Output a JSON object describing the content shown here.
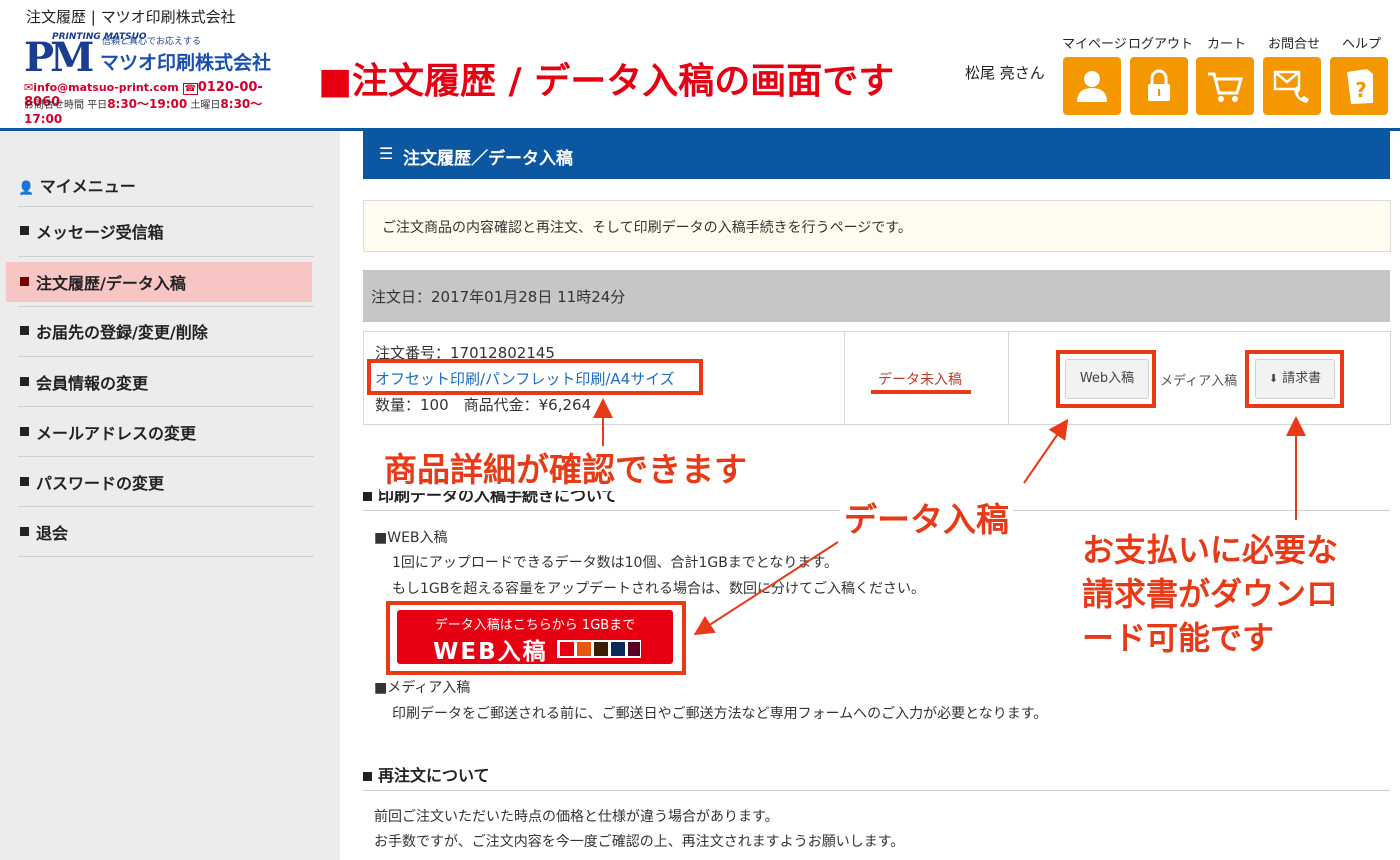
{
  "window": {
    "title": "注文履歴 | マツオ印刷株式会社"
  },
  "logo": {
    "mark": "PM",
    "printing": "PRINTING MATSUO",
    "tagline": "信頼と真心でお応えする",
    "company": "マツオ印刷株式会社",
    "email": "info@matsuo-print.com",
    "phone": "0120-00-8060",
    "hours_label": "お問合せ時間",
    "weekday": "平日",
    "weekday_hours": "8:30〜19:00",
    "saturday": "土曜日",
    "saturday_hours": "8:30〜17:00"
  },
  "banner": "■注文履歴 / データ入稿の画面です",
  "user": {
    "name": "松尾 亮さん"
  },
  "nav": [
    {
      "label": "マイページ",
      "icon": "user-icon"
    },
    {
      "label": "ログアウト",
      "icon": "lock-icon"
    },
    {
      "label": "カート",
      "icon": "cart-icon"
    },
    {
      "label": "お問合せ",
      "icon": "mail-phone-icon"
    },
    {
      "label": "ヘルプ",
      "icon": "help-book-icon"
    }
  ],
  "sidebar": {
    "heading": "マイメニュー",
    "items": [
      {
        "label": "メッセージ受信箱"
      },
      {
        "label": "注文履歴/データ入稿",
        "active": true
      },
      {
        "label": "お届先の登録/変更/削除"
      },
      {
        "label": "会員情報の変更"
      },
      {
        "label": "メールアドレスの変更"
      },
      {
        "label": "パスワードの変更"
      },
      {
        "label": "退会"
      }
    ]
  },
  "main": {
    "title": "注文履歴／データ入稿",
    "intro": "ご注文商品の内容確認と再注文、そして印刷データの入稿手続きを行うページです。",
    "order_date": "注文日：2017年01月28日 11時24分",
    "order": {
      "number": "注文番号：17012802145",
      "product_link": "オフセット印刷/パンフレット印刷/A4サイズ",
      "quantity": "数量：100　商品代金：¥6,264",
      "status": "データ未入稿",
      "web_upload_button": "Web入稿",
      "media_upload_button": "メディア入稿",
      "invoice_button": "請求書"
    },
    "upload_section": {
      "title": "印刷データの入稿手続きについて",
      "web_heading": "■WEB入稿",
      "web_line1": "1回にアップロードできるデータ数は10個、合計1GBまでとなります。",
      "web_line2": "もし1GBを超える容量をアップデートされる場合は、数回に分けてご入稿ください。",
      "web_button_line1": "データ入稿はこちらから 1GBまで",
      "web_button_line2": "WEB入稿",
      "media_heading": "■メディア入稿",
      "media_line": "印刷データをご郵送される前に、ご郵送日やご郵送方法など専用フォームへのご入力が必要となります。"
    },
    "reorder_section": {
      "title": "再注文について",
      "line1": "前回ご注文いただいた時点の価格と仕様が違う場合があります。",
      "line2": "お手数ですが、ご注文内容を今一度ご確認の上、再注文されますようお願いします。"
    }
  },
  "annotations": {
    "product_detail": "商品詳細が確認できます",
    "data_upload": "データ入稿",
    "invoice_line1": "お支払いに必要な",
    "invoice_line2": "請求書がダウンロ",
    "invoice_line3": "ード可能です"
  },
  "colors": {
    "accent": "#0b57a2",
    "nav_button": "#f59700",
    "annotation": "#e83a16",
    "active_item": "#f8c5c5"
  }
}
